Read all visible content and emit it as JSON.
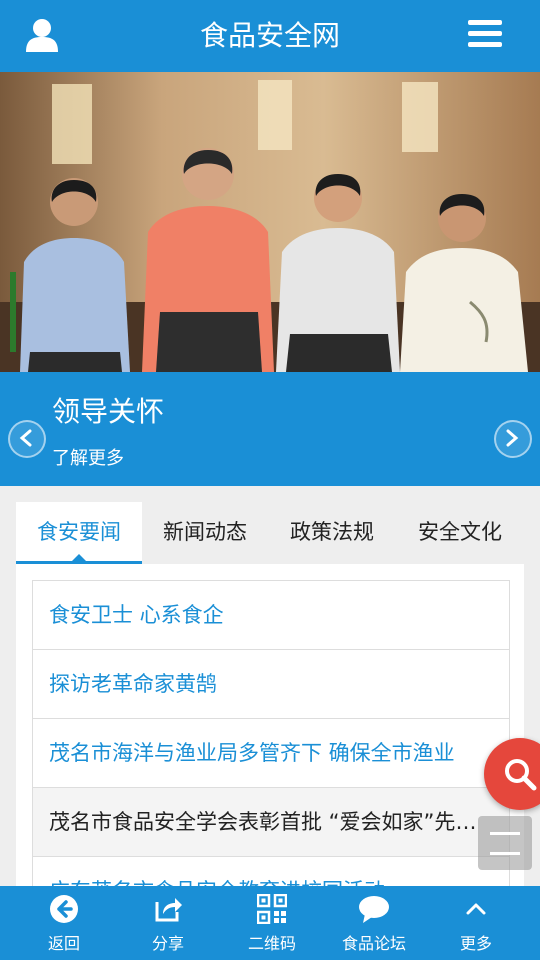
{
  "header": {
    "title": "食品安全网"
  },
  "banner": {
    "caption_title": "领导关怀",
    "caption_more": "了解更多"
  },
  "tabs": [
    {
      "label": "食安要闻"
    },
    {
      "label": "新闻动态"
    },
    {
      "label": "政策法规"
    },
    {
      "label": "安全文化"
    }
  ],
  "news": [
    {
      "title": "食安卫士 心系食企"
    },
    {
      "title": "探访老革命家黄鹄"
    },
    {
      "title": "茂名市海洋与渔业局多管齐下 确保全市渔业"
    },
    {
      "title": "茂名市食品安全学会表彰首批 “爱会如家”先进个人"
    },
    {
      "title": "广东茂名市食品安全教育进校园活动"
    }
  ],
  "bottom_nav": [
    {
      "label": "返回",
      "icon": "back-icon"
    },
    {
      "label": "分享",
      "icon": "share-icon"
    },
    {
      "label": "二维码",
      "icon": "qrcode-icon"
    },
    {
      "label": "食品论坛",
      "icon": "chat-icon"
    },
    {
      "label": "更多",
      "icon": "chevron-up-icon"
    }
  ],
  "colors": {
    "primary": "#1a8fd6",
    "search_fab": "#e5473c"
  }
}
